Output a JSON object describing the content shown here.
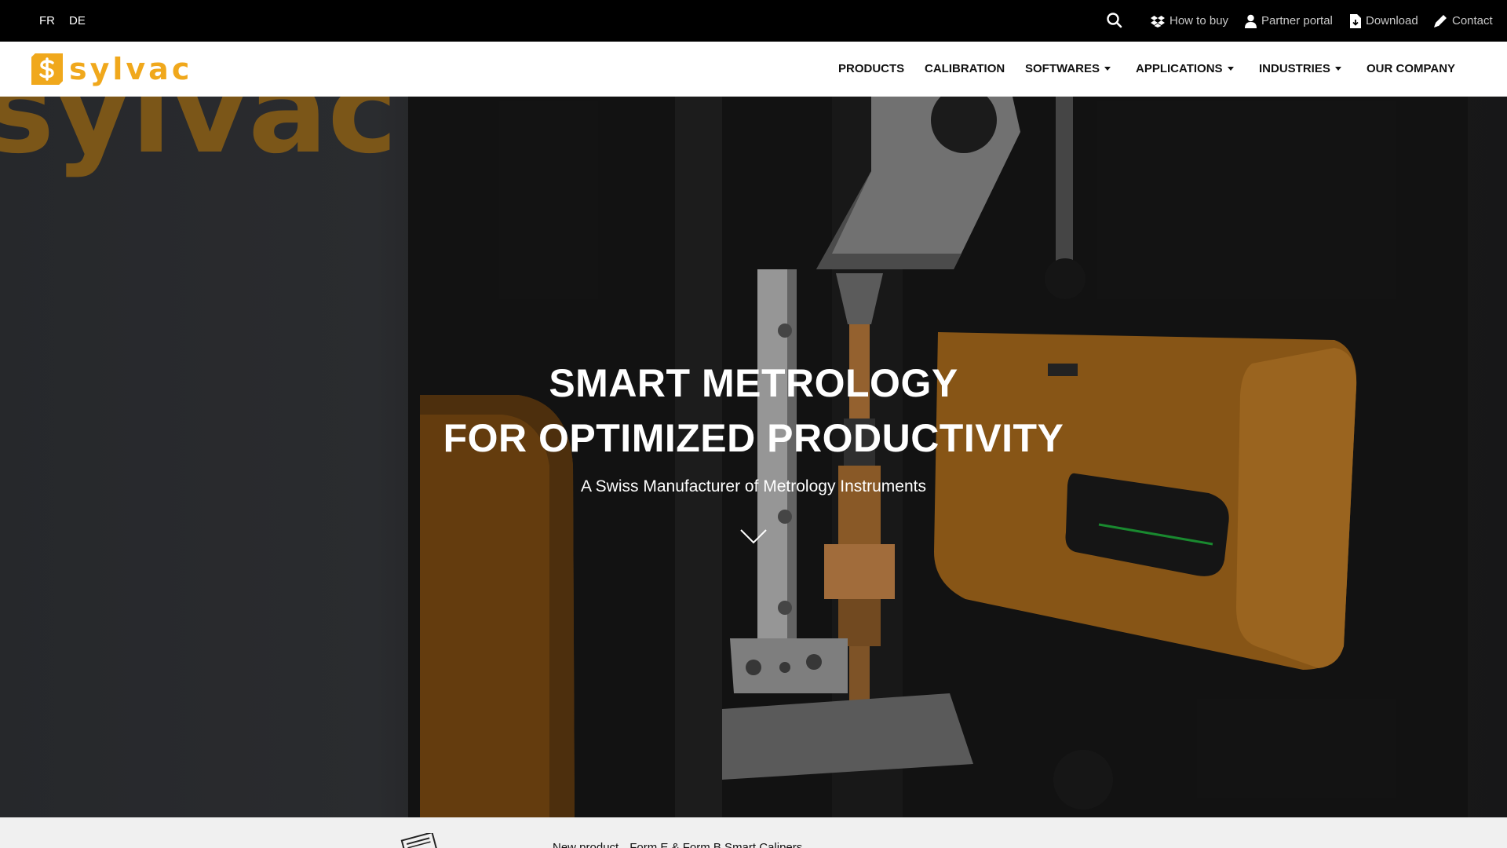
{
  "topbar": {
    "languages": [
      "FR",
      "DE"
    ],
    "links": {
      "how_to_buy": "How to buy",
      "partner_portal": "Partner portal",
      "download": "Download",
      "contact": "Contact"
    }
  },
  "logo": {
    "text": "sylvac"
  },
  "nav": {
    "products": "PRODUCTS",
    "calibration": "CALIBRATION",
    "softwares": "SOFTWARES",
    "applications": "APPLICATIONS",
    "industries": "INDUSTRIES",
    "our_company": "OUR COMPANY"
  },
  "hero": {
    "title_line1": "SMART METROLOGY",
    "title_line2": "FOR OPTIMIZED PRODUCTIVITY",
    "subtitle": "A Swiss Manufacturer of Metrology Instruments",
    "background_text": "sylvac"
  },
  "news": {
    "label": "New product",
    "text": "Form E & Form B Smart Calipers"
  },
  "colors": {
    "brand": "#f0a81c",
    "topbar": "#000000",
    "nav_bg": "#ffffff",
    "news_bg": "#f0f0f0"
  },
  "icons": [
    "search-icon",
    "dropbox-icon",
    "user-icon",
    "file-download-icon",
    "pencil-icon",
    "chevron-down-icon",
    "newspaper-icon"
  ]
}
